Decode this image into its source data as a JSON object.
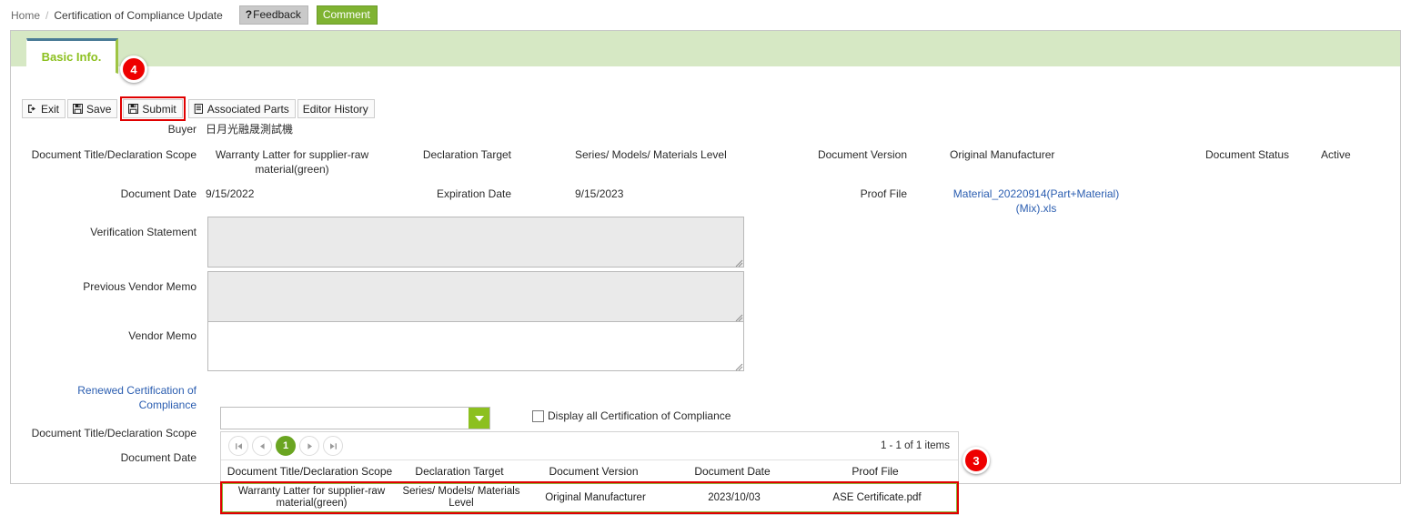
{
  "breadcrumb": {
    "home": "Home",
    "separator": "/",
    "current": "Certification of Compliance Update"
  },
  "header_actions": {
    "feedback_label": "Feedback",
    "feedback_icon": "question-mark-icon",
    "comment_label": "Comment"
  },
  "tabs": [
    {
      "label": "Basic Info.",
      "active": true
    }
  ],
  "callouts": [
    {
      "number": "4"
    },
    {
      "number": "3"
    }
  ],
  "toolbar": {
    "exit_label": "Exit",
    "save_label": "Save",
    "submit_label": "Submit",
    "associated_parts_label": "Associated Parts",
    "editor_history_label": "Editor History"
  },
  "form": {
    "buyer_label": "Buyer",
    "buyer_value": "日月光融晟測試機",
    "doc_title_label": "Document Title/Declaration Scope",
    "doc_title_value": "Warranty Latter for supplier-raw material(green)",
    "declaration_target_label": "Declaration Target",
    "declaration_target_value": "Series/ Models/ Materials Level",
    "document_version_label": "Document Version",
    "document_version_value": "Original Manufacturer",
    "document_status_label": "Document Status",
    "document_status_value": "Active",
    "document_date_label": "Document Date",
    "document_date_value": "9/15/2022",
    "expiration_date_label": "Expiration Date",
    "expiration_date_value": "9/15/2023",
    "proof_file_label": "Proof File",
    "proof_file_value": "Material_20220914(Part+Material)(Mix).xls",
    "verification_statement_label": "Verification Statement",
    "verification_statement_value": "",
    "previous_vendor_memo_label": "Previous Vendor Memo",
    "previous_vendor_memo_value": "",
    "vendor_memo_label": "Vendor Memo",
    "vendor_memo_value": "",
    "renewed_cert_label": "Renewed Certification of Compliance",
    "renewed_cert_value": "",
    "display_all_label": "Display all Certification of Compliance",
    "bottom_doc_title_label": "Document Title/Declaration Scope",
    "bottom_doc_date_label": "Document Date"
  },
  "grid": {
    "pager": {
      "first_icon": "first-page-icon",
      "prev_icon": "previous-page-icon",
      "current_page": "1",
      "next_icon": "next-page-icon",
      "last_icon": "last-page-icon",
      "info": "1 - 1 of 1 items"
    },
    "columns": [
      "Document Title/Declaration Scope",
      "Declaration Target",
      "Document Version",
      "Document Date",
      "Proof File"
    ],
    "rows": [
      {
        "doc_title": "Warranty Latter for supplier-raw material(green)",
        "declaration_target": "Series/ Models/ Materials Level",
        "document_version": "Original Manufacturer",
        "document_date": "2023/10/03",
        "proof_file": "ASE Certificate.pdf"
      }
    ]
  },
  "colors": {
    "tab_strip": "#d6e8c4",
    "accent_green": "#8cc01f",
    "comment_green": "#7fb332",
    "callout_red": "#ee0000",
    "link_blue": "#2a5db0",
    "highlight_red": "#e00000"
  }
}
